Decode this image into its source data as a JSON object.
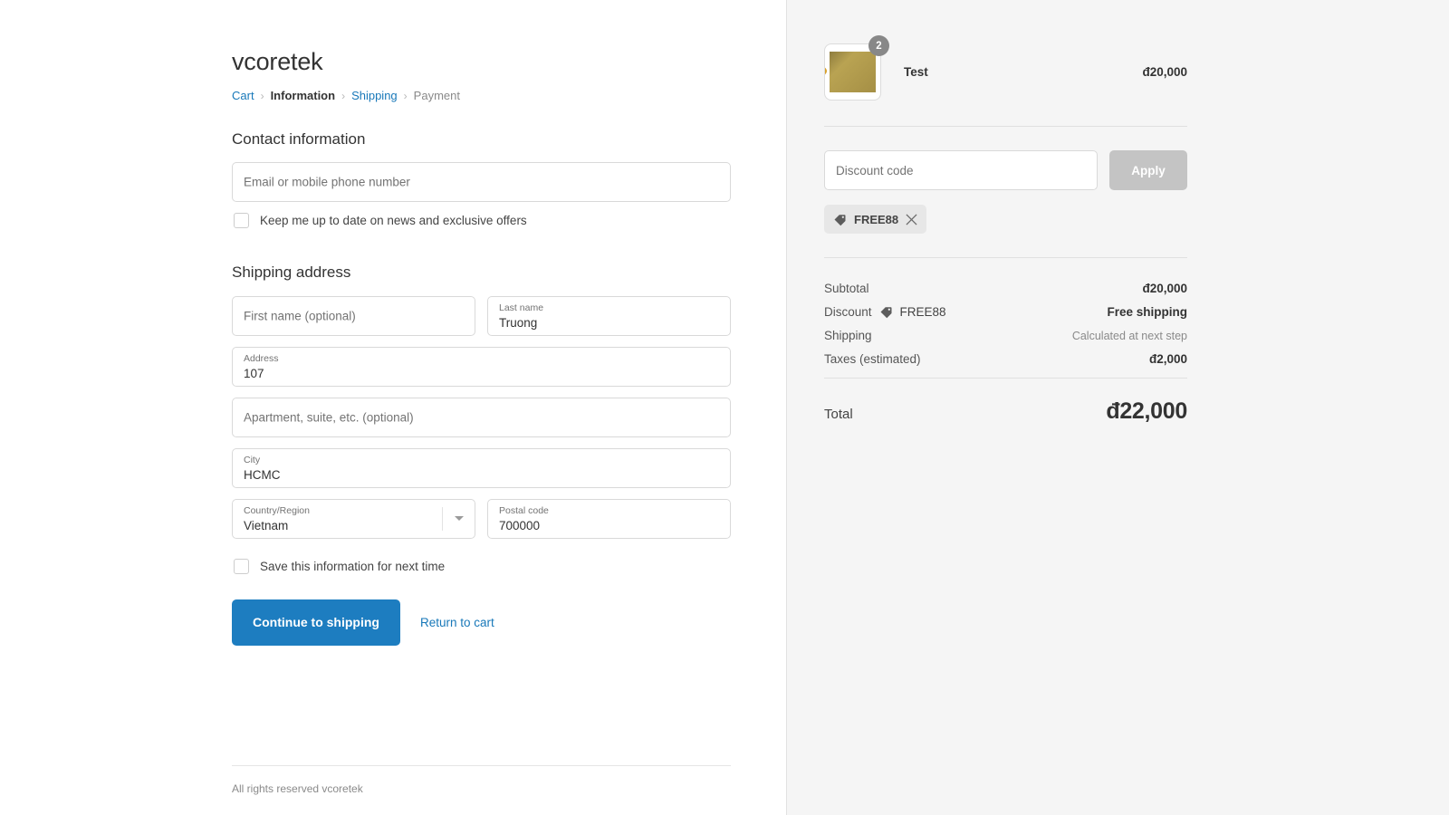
{
  "shop": {
    "name": "vcoretek"
  },
  "breadcrumb": {
    "cart": "Cart",
    "information": "Information",
    "shipping": "Shipping",
    "payment": "Payment",
    "separator": "›"
  },
  "contact": {
    "section_title": "Contact information",
    "email_placeholder": "Email or mobile phone number",
    "email_value": "",
    "newsletter_label": "Keep me up to date on news and exclusive offers",
    "newsletter_checked": false
  },
  "shipping_address": {
    "section_title": "Shipping address",
    "first_name": {
      "placeholder": "First name (optional)",
      "label": "First name",
      "value": ""
    },
    "last_name": {
      "placeholder": "Last name",
      "label": "Last name",
      "value": "Truong"
    },
    "address": {
      "placeholder": "Address",
      "label": "Address",
      "value": "107"
    },
    "apartment": {
      "placeholder": "Apartment, suite, etc. (optional)",
      "label": "Apartment",
      "value": ""
    },
    "city": {
      "placeholder": "City",
      "label": "City",
      "value": "HCMC"
    },
    "country": {
      "placeholder": "Country/Region",
      "label": "Country/Region",
      "value": "Vietnam"
    },
    "postal_code": {
      "placeholder": "Postal code",
      "label": "Postal code",
      "value": "700000"
    },
    "save_info_label": "Save this information for next time",
    "save_info_checked": false
  },
  "actions": {
    "continue_label": "Continue to shipping",
    "return_label": "Return to cart"
  },
  "footer": {
    "text": "All rights reserved vcoretek"
  },
  "summary": {
    "item": {
      "name": "Test",
      "price": "đ20,000",
      "quantity": "2",
      "image_alt": "certificate-photo"
    },
    "discount": {
      "placeholder": "Discount code",
      "value": "",
      "apply_label": "Apply",
      "applied_code": "FREE88"
    },
    "lines": [
      {
        "label": "Subtotal",
        "value": "đ20,000",
        "muted": false,
        "tag": null
      },
      {
        "label": "Discount",
        "value": "Free shipping",
        "muted": false,
        "tag": "FREE88"
      },
      {
        "label": "Shipping",
        "value": "Calculated at next step",
        "muted": true,
        "tag": null
      },
      {
        "label": "Taxes (estimated)",
        "value": "đ2,000",
        "muted": false,
        "tag": null
      }
    ],
    "total": {
      "label": "Total",
      "value": "đ22,000"
    }
  },
  "colors": {
    "accent": "#1d7dc0",
    "link": "#1878b9",
    "sidebar_bg": "#f5f5f5",
    "badge": "#888888",
    "disabled_button": "#c4c4c4"
  }
}
